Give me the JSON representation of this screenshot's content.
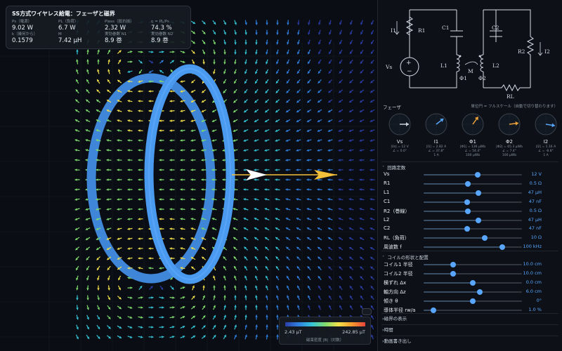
{
  "info": {
    "title": "SS方式ワイヤレス給電：フェーザと磁界",
    "cells": [
      {
        "key": "Ps（電源）",
        "value": "9.02 W"
      },
      {
        "key": "PL（負荷）",
        "value": "6.7 W"
      },
      {
        "key": "Ploss（抵抗損）",
        "value": "2.32 W"
      },
      {
        "key": "η = PL/Ps",
        "value": "74.3 %"
      },
      {
        "key": "k（幾何から）",
        "value": "0.1579"
      },
      {
        "key": "M",
        "value": "7.42 μH"
      },
      {
        "key": "実効巻数 N1",
        "value": "8.9 巻"
      },
      {
        "key": "実効巻数 N2",
        "value": "8.9 巻"
      }
    ]
  },
  "colorbar": {
    "min": "2.43 μT",
    "max": "242.85 μT",
    "label": "磁束密度 |B|（対数）"
  },
  "circuit": {
    "labels": {
      "I1": "I1",
      "R1": "R1",
      "C1": "C1",
      "C2": "C2",
      "R2": "R2",
      "I2": "I2",
      "Vs": "Vs",
      "L1": "L1",
      "M": "M",
      "L2": "L2",
      "Phi1": "Φ1",
      "Phi2": "Φ2",
      "RL": "RL"
    }
  },
  "phasors": {
    "title": "フェーザ",
    "note": "単位円 = フルスケール（自動で切り替わります）",
    "items": [
      {
        "name": "Vs",
        "d1": "|Vs| = 12 V",
        "d2": "∠ = 0.0°",
        "d3": "",
        "angle": 0,
        "color": "#c9d1d9"
      },
      {
        "name": "I1",
        "d1": "|I1| = 2.82 A",
        "d2": "∠ = 37.8°",
        "d3": "1 A",
        "angle": 37.8,
        "color": "#58a6ff"
      },
      {
        "name": "Φ1",
        "d1": "|Φ1| = 136 μWb",
        "d2": "∠ = 54.4°",
        "d3": "100 μWb",
        "angle": 54.4,
        "color": "#f0a33a"
      },
      {
        "name": "Φ2",
        "d1": "|Φ2| = 65.3 μWb",
        "d2": "∠ = 7.4°",
        "d3": "100 μWb",
        "angle": 7.4,
        "color": "#f0a33a"
      },
      {
        "name": "I2",
        "d1": "|I2| = 1.16 A",
        "d2": "∠ = -8.8°",
        "d3": "1 A",
        "angle": -8.8,
        "color": "#58a6ff"
      }
    ]
  },
  "circuit_params": {
    "title": "回路定数",
    "rows": [
      {
        "label": "Vs",
        "value": "12 V",
        "level": 0.55
      },
      {
        "label": "R1",
        "value": "0.5 Ω",
        "level": 0.45
      },
      {
        "label": "L1",
        "value": "47 μH",
        "level": 0.56
      },
      {
        "label": "C1",
        "value": "47 nF",
        "level": 0.44
      },
      {
        "label": "R2（巻線）",
        "value": "0.5 Ω",
        "level": 0.45
      },
      {
        "label": "L2",
        "value": "47 μH",
        "level": 0.56
      },
      {
        "label": "C2",
        "value": "47 nF",
        "level": 0.44
      },
      {
        "label": "RL（負荷）",
        "value": "10 Ω",
        "level": 0.62
      },
      {
        "label": "周波数 f",
        "value": "100 kHz",
        "level": 0.8
      }
    ]
  },
  "coil_params": {
    "title": "コイルの形状と配置",
    "rows": [
      {
        "label": "コイル1 半径",
        "value": "10.0 cm",
        "level": 0.3
      },
      {
        "label": "コイル2 半径",
        "value": "10.0 cm",
        "level": 0.3
      },
      {
        "label": "横ずれ Δx",
        "value": "0.0 cm",
        "level": 0.5
      },
      {
        "label": "軸方向 Δz",
        "value": "6.0 cm",
        "level": 0.57
      },
      {
        "label": "傾き θ",
        "value": "0°",
        "level": 0.5
      },
      {
        "label": "導体半径 rw/a",
        "value": "1.0 %",
        "level": 0.1
      }
    ]
  },
  "collapsed_sections": [
    "磁界の表示",
    "時間",
    "動画書き出し"
  ]
}
